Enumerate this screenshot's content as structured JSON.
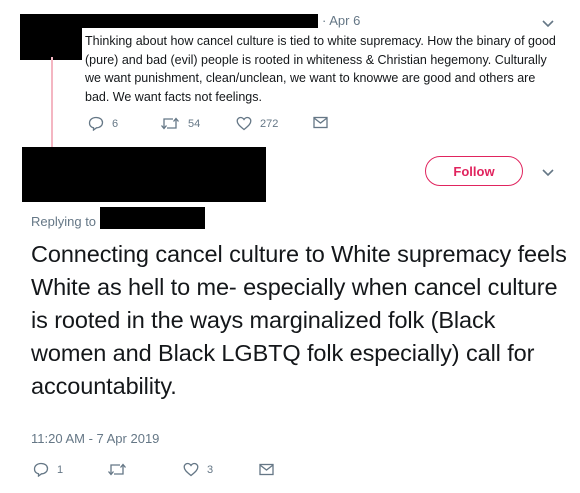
{
  "tweet1": {
    "date": "· Apr 6",
    "text": "Thinking about how cancel culture is tied to white supremacy. How the binary of good (pure) and bad (evil) people is rooted in whiteness & Christian hegemony. Culturally we want punishment, clean/unclean, we want to knowwe are good and others are bad. We want facts not feelings.",
    "replies": "6",
    "retweets": "54",
    "likes": "272"
  },
  "tweet2": {
    "follow_label": "Follow",
    "replying_to": "Replying to",
    "text": "Connecting cancel culture to White supremacy feels White as hell to me- especially when cancel culture is rooted in the ways marginalized folk (Black women and Black LGBTQ folk especially) call for accountability.",
    "timestamp": "11:20 AM - 7 Apr 2019",
    "replies": "1",
    "likes": "3"
  },
  "colors": {
    "accent": "#e0245e",
    "muted": "#657786",
    "thread_line": "#f4b6c2",
    "text": "#14171a"
  },
  "icons": [
    "reply-icon",
    "retweet-icon",
    "like-icon",
    "dm-icon",
    "chevron-down-icon"
  ]
}
